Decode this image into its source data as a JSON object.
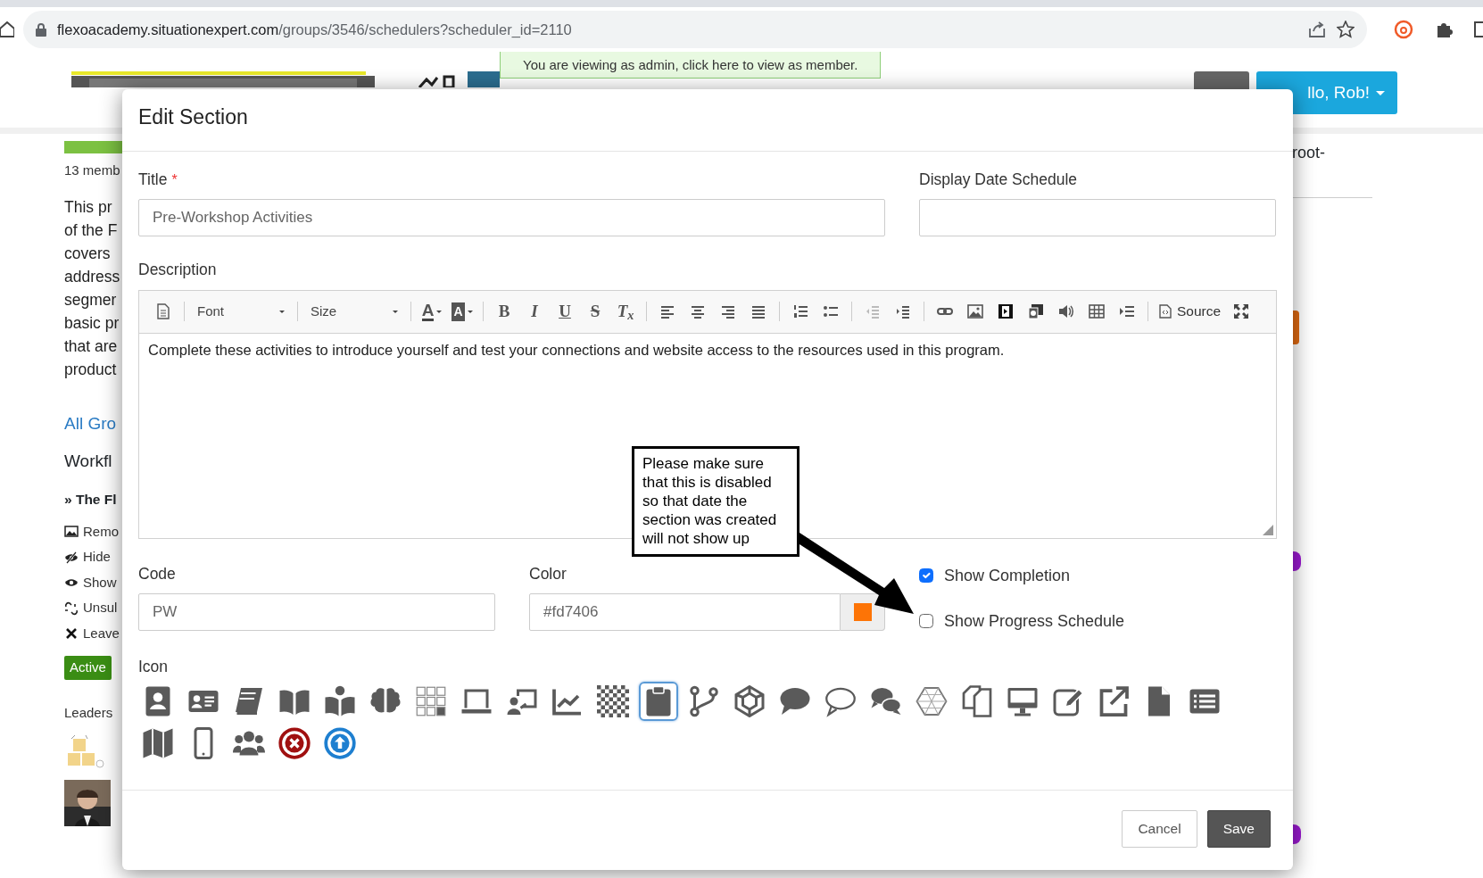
{
  "browser": {
    "url_host": "flexoacademy.situationexpert.com",
    "url_path": "/groups/3546/schedulers?scheduler_id=2110"
  },
  "header": {
    "admin_notice": "You are viewing as admin, click here to view as member.",
    "user_button": "llo, Rob!"
  },
  "background_left": {
    "members": "13 memb",
    "description_lines": [
      "This pr",
      "of the F",
      "covers",
      "address",
      "segmer",
      "basic pr",
      "that are",
      "product"
    ],
    "link": "All Gro",
    "heading": "Workfl",
    "workflow_item": "» The Fl",
    "actions": [
      "Remo",
      "Hide",
      "Show",
      "Unsul",
      "Leave"
    ],
    "status_badge": "Active",
    "leaders_label": "Leaders"
  },
  "background_right": {
    "text": "root-"
  },
  "modal": {
    "title": "Edit Section",
    "title_field": {
      "label": "Title",
      "required_mark": "*",
      "value": "Pre-Workshop Activities"
    },
    "display_date_field": {
      "label": "Display Date Schedule"
    },
    "description": {
      "label": "Description",
      "toolbar": {
        "font": "Font",
        "size": "Size",
        "glyphs": [
          "A",
          "A",
          "B",
          "I",
          "U",
          "S",
          "T$_{x}$"
        ],
        "source": "Source"
      },
      "content": "Complete these activities to introduce yourself and test your connections and website access to the resources used in this program."
    },
    "code_field": {
      "label": "Code",
      "value": "PW"
    },
    "color_field": {
      "label": "Color",
      "value": "#fd7406"
    },
    "checkboxes": [
      {
        "label": "Show Completion",
        "checked": true
      },
      {
        "label": "Show Progress Schedule",
        "checked": false
      }
    ],
    "icon_label": "Icon",
    "icons": [
      {
        "selected": false
      },
      {
        "selected": false
      },
      {
        "selected": false
      },
      {
        "selected": false
      },
      {
        "selected": false
      },
      {
        "selected": false
      },
      {
        "selected": false
      },
      {
        "selected": false
      },
      {
        "selected": false
      },
      {
        "selected": false
      },
      {
        "selected": false
      },
      {
        "selected": true
      },
      {
        "selected": false
      },
      {
        "selected": false
      },
      {
        "selected": false
      },
      {
        "selected": false
      },
      {
        "selected": false
      },
      {
        "selected": false
      },
      {
        "selected": false
      },
      {
        "selected": false
      },
      {
        "selected": false
      },
      {
        "selected": false
      },
      {
        "selected": false
      },
      {
        "selected": false
      },
      {
        "selected": false
      },
      {
        "selected": false
      },
      {
        "selected": false
      },
      {
        "selected": false
      },
      {
        "selected": false
      }
    ],
    "buttons": [
      {
        "label": "Cancel",
        "kind": "secondary"
      },
      {
        "label": "Save",
        "kind": "primary"
      }
    ]
  },
  "annotation": {
    "text": "Please make sure that this is disabled so that date the section was created will not show up"
  }
}
